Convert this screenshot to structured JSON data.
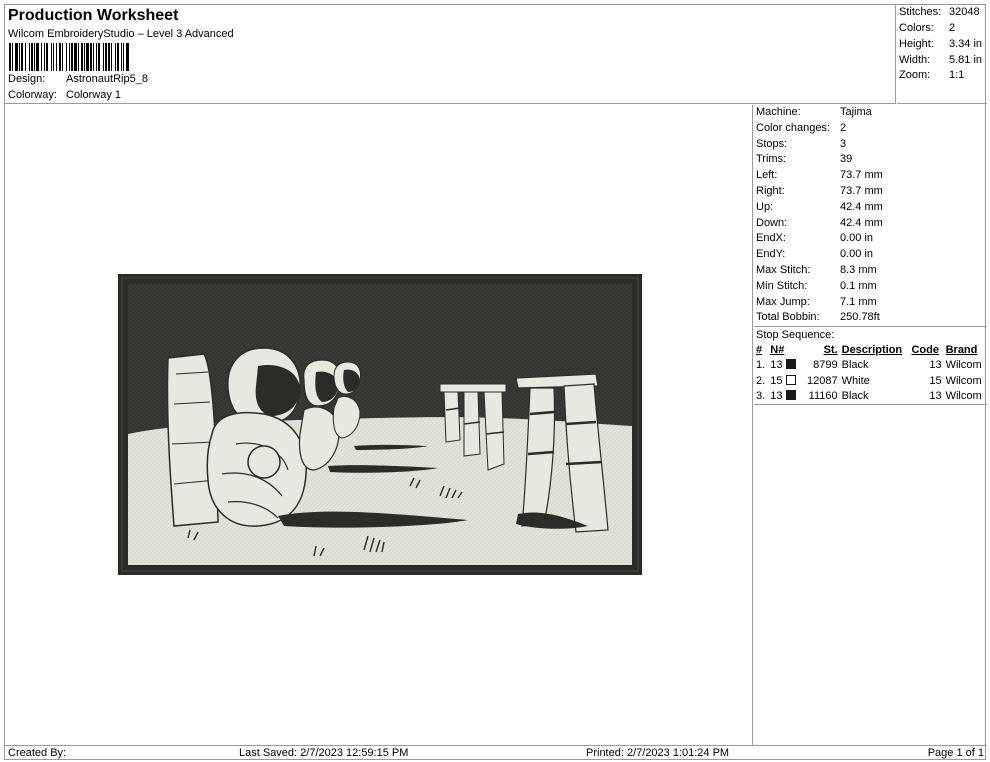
{
  "header": {
    "title": "Production Worksheet",
    "subtitle": "Wilcom EmbroideryStudio – Level 3 Advanced",
    "design_label": "Design:",
    "design_value": "AstronautRip5_8",
    "colorway_label": "Colorway:",
    "colorway_value": "Colorway 1"
  },
  "summary": {
    "stitches_label": "Stitches:",
    "stitches_value": "32048",
    "colors_label": "Colors:",
    "colors_value": "2",
    "height_label": "Height:",
    "height_value": "3.34 in",
    "width_label": "Width:",
    "width_value": "5.81 in",
    "zoom_label": "Zoom:",
    "zoom_value": "1:1"
  },
  "machine_info": [
    {
      "label": "Machine:",
      "value": "Tajima"
    },
    {
      "label": "Color changes:",
      "value": "2"
    },
    {
      "label": "Stops:",
      "value": "3"
    },
    {
      "label": "Trims:",
      "value": "39"
    },
    {
      "label": "Left:",
      "value": "73.7 mm"
    },
    {
      "label": "Right:",
      "value": "73.7 mm"
    },
    {
      "label": "Up:",
      "value": "42.4 mm"
    },
    {
      "label": "Down:",
      "value": "42.4 mm"
    },
    {
      "label": "EndX:",
      "value": "0.00 in"
    },
    {
      "label": "EndY:",
      "value": "0.00 in"
    },
    {
      "label": "Max Stitch:",
      "value": "8.3 mm"
    },
    {
      "label": "Min Stitch:",
      "value": "0.1 mm"
    },
    {
      "label": "Max Jump:",
      "value": "7.1 mm"
    },
    {
      "label": "Total Bobbin:",
      "value": "250.78ft"
    }
  ],
  "stop_sequence": {
    "title": "Stop Sequence:",
    "headers": {
      "num": "#",
      "n": "N#",
      "st": "St.",
      "desc": "Description",
      "code": "Code",
      "brand": "Brand"
    },
    "rows": [
      {
        "num": "1.",
        "n": "13",
        "swatch": "#1a1a1a",
        "st": "8799",
        "desc": "Black",
        "code": "13",
        "brand": "Wilcom"
      },
      {
        "num": "2.",
        "n": "15",
        "swatch": "#ffffff",
        "st": "12087",
        "desc": "White",
        "code": "15",
        "brand": "Wilcom"
      },
      {
        "num": "3.",
        "n": "13",
        "swatch": "#1a1a1a",
        "st": "11160",
        "desc": "Black",
        "code": "13",
        "brand": "Wilcom"
      }
    ]
  },
  "footer": {
    "created_by": "Created By:",
    "last_saved": "Last Saved: 2/7/2023 12:59:15 PM",
    "printed": "Printed: 2/7/2023 1:01:24 PM",
    "page": "Page 1 of 1"
  },
  "colors": {
    "thread_black": "#2b2b27",
    "thread_white": "#dfe3d8",
    "border_gray": "#9a9a9a"
  }
}
